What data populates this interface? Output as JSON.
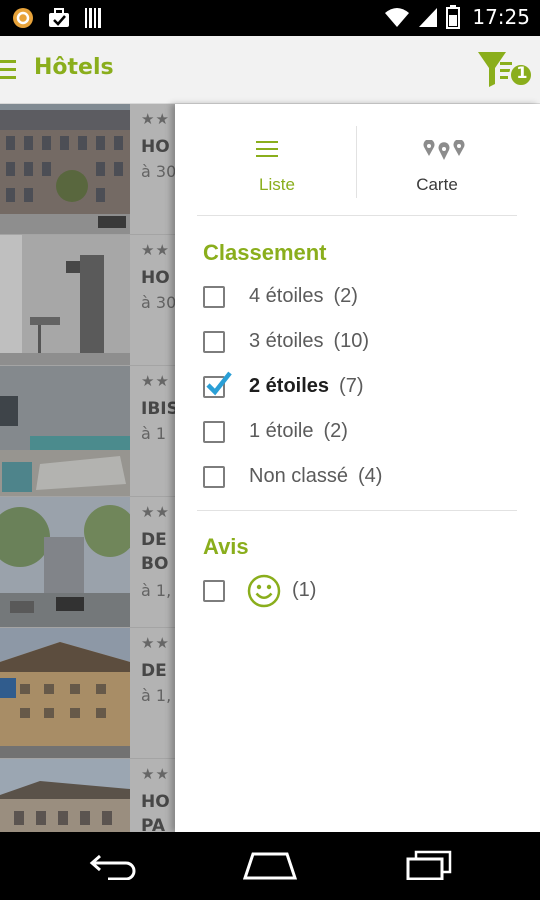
{
  "status_bar": {
    "time": "17:25",
    "left_icons": [
      "notification-icon",
      "briefcase-icon",
      "barcode-icon"
    ],
    "right_icons": [
      "wifi-icon",
      "signal-icon",
      "battery-icon"
    ]
  },
  "app_bar": {
    "title": "Hôtels",
    "filter_badge": "1",
    "accent_color": "#8aae1c"
  },
  "hotel_list": [
    {
      "stars": "★★",
      "name": "HO",
      "distance": "à 30"
    },
    {
      "stars": "★★",
      "name": "HO",
      "distance": "à 30"
    },
    {
      "stars": "★★",
      "name": "IBIS",
      "distance": "à 1"
    },
    {
      "stars": "★★",
      "name": "DE",
      "name2": "BO",
      "distance": "à 1,"
    },
    {
      "stars": "★★",
      "name": "DE",
      "distance": "à 1,"
    },
    {
      "stars": "★★",
      "name": "HO",
      "name2": "PA",
      "distance": ""
    }
  ],
  "drawer": {
    "view_toggle": {
      "liste_label": "Liste",
      "carte_label": "Carte",
      "selected": "Liste"
    },
    "classement": {
      "title": "Classement",
      "options": [
        {
          "label": "4 étoiles",
          "count": "(2)",
          "checked": false
        },
        {
          "label": "3 étoiles",
          "count": "(10)",
          "checked": false
        },
        {
          "label": "2 étoiles",
          "count": "(7)",
          "checked": true
        },
        {
          "label": "1 étoile",
          "count": "(2)",
          "checked": false
        },
        {
          "label": "Non classé",
          "count": "(4)",
          "checked": false
        }
      ]
    },
    "avis": {
      "title": "Avis",
      "options": [
        {
          "icon": "smiley-icon",
          "count": "(1)",
          "checked": false
        }
      ]
    }
  },
  "nav_bar": {
    "buttons": [
      "back-icon",
      "home-icon",
      "recents-icon"
    ]
  }
}
